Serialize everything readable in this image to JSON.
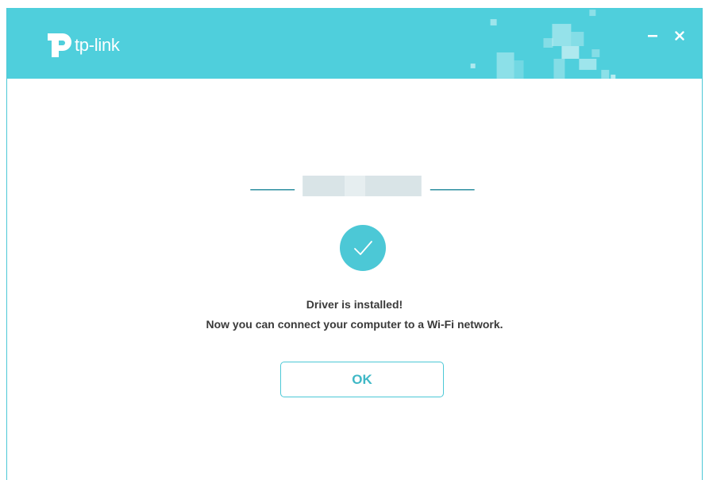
{
  "window": {
    "brand": "tp-link",
    "minimize_icon": "minimize-icon",
    "close_icon": "close-icon"
  },
  "progress": {
    "steps": 3,
    "current_step": 2
  },
  "status": {
    "icon": "checkmark-icon",
    "line1": "Driver is installed!",
    "line2": "Now you can connect your computer to a Wi-Fi network."
  },
  "actions": {
    "ok_label": "OK"
  },
  "colors": {
    "accent": "#4fcfdc",
    "check": "#4cc8d6",
    "button_text": "#3fb8c6",
    "text": "#3a3a3a"
  }
}
